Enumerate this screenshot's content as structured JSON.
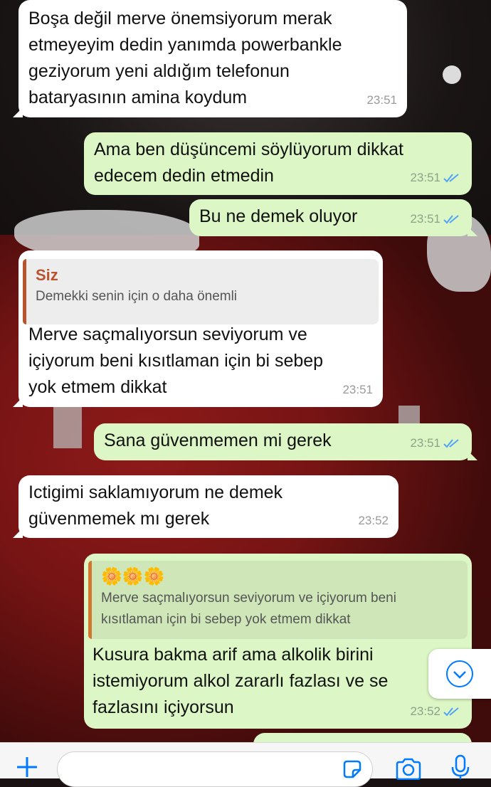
{
  "messages": [
    {
      "direction": "in",
      "text": "Boşa değil merve önemsiyorum merak\netmeyeyim dedin yanımda powerbankle\ngeziyorum yeni aldığım telefonun\nbataryasının amina koydum",
      "time": "23:51"
    },
    {
      "direction": "out",
      "text": "Ama ben düşüncemi söylüyorum dikkat\nedecem dedin etmedin",
      "time": "23:51",
      "status": "read"
    },
    {
      "direction": "out",
      "text": "Bu ne demek oluyor",
      "time": "23:51",
      "status": "read"
    },
    {
      "direction": "in",
      "reply": {
        "author": "Siz",
        "text": "Demekki senin için o daha önemli"
      },
      "text": "Merve saçmalıyorsun seviyorum ve\niçiyorum beni kısıtlaman için bi sebep\nyok etmem dikkat",
      "time": "23:51"
    },
    {
      "direction": "out",
      "text": "Sana güvenmemen mi gerek",
      "time": "23:51",
      "status": "read"
    },
    {
      "direction": "in",
      "text": "Ictigimi saklamıyorum ne demek\ngüvenmemek mı gerek",
      "time": "23:52"
    },
    {
      "direction": "out",
      "reply": {
        "author": "🌼🌼🌼",
        "text": "Merve saçmalıyorsun seviyorum ve içiyorum beni\nkısıtlaman için bi sebep yok etmem dikkat"
      },
      "text": "Kusura bakma arif ama alkolik birini\nistemiyorum alkol zararlı fazlası ve se\nfazlasını içiyorsun",
      "time": "23:52",
      "status": "read"
    }
  ],
  "icons": {
    "read_receipt": "double-check-icon",
    "attach": "plus-icon",
    "sticker": "sticker-icon",
    "camera": "camera-icon",
    "mic": "microphone-icon",
    "scroll": "chevron-down-icon"
  },
  "colors": {
    "incoming_bubble": "#ffffff",
    "outgoing_bubble": "#dcf7c5",
    "read_tick": "#4fa3f7",
    "accent": "#007aff"
  }
}
